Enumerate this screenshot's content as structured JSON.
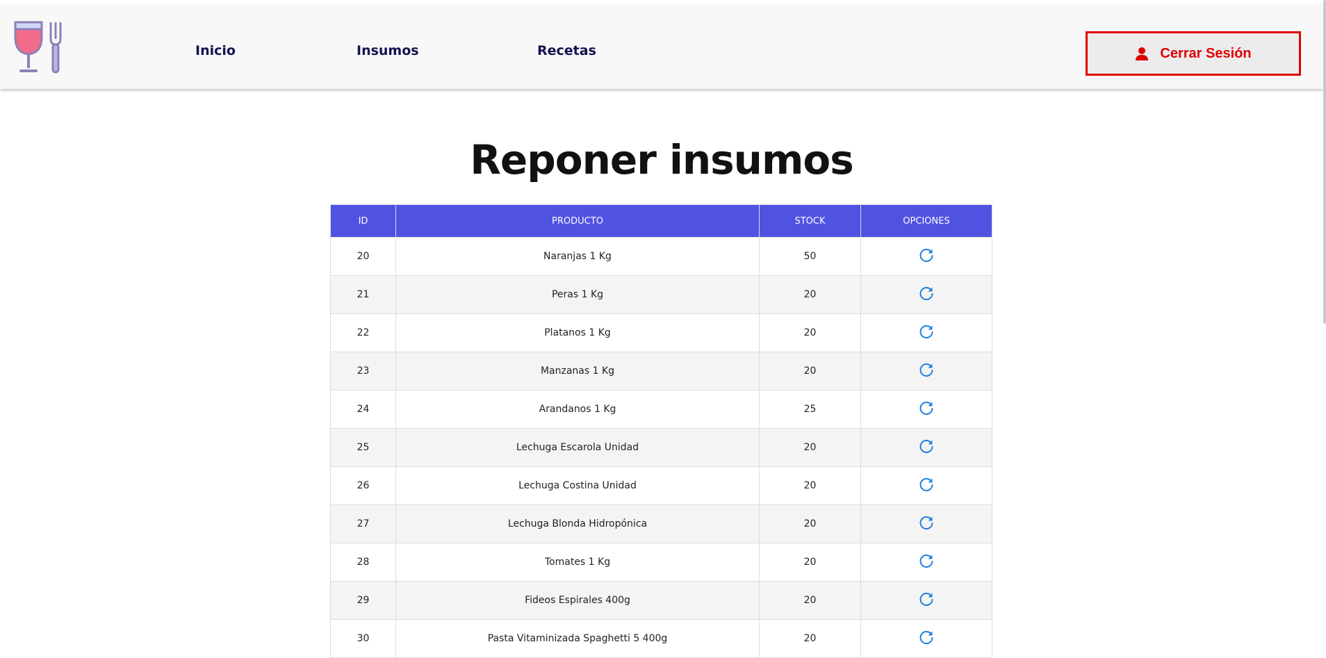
{
  "nav": {
    "links": [
      "Inicio",
      "Insumos",
      "Recetas"
    ],
    "logout_label": "Cerrar Sesión"
  },
  "page": {
    "title": "Reponer insumos"
  },
  "table": {
    "headers": [
      "ID",
      "PRODUCTO",
      "STOCK",
      "OPCIONES"
    ],
    "rows": [
      {
        "id": "20",
        "producto": "Naranjas 1 Kg",
        "stock": "50"
      },
      {
        "id": "21",
        "producto": "Peras 1 Kg",
        "stock": "20"
      },
      {
        "id": "22",
        "producto": "Platanos 1 Kg",
        "stock": "20"
      },
      {
        "id": "23",
        "producto": "Manzanas 1 Kg",
        "stock": "20"
      },
      {
        "id": "24",
        "producto": "Arandanos 1 Kg",
        "stock": "25"
      },
      {
        "id": "25",
        "producto": "Lechuga Escarola Unidad",
        "stock": "20"
      },
      {
        "id": "26",
        "producto": "Lechuga Costina Unidad",
        "stock": "20"
      },
      {
        "id": "27",
        "producto": "Lechuga Blonda Hidropónica",
        "stock": "20"
      },
      {
        "id": "28",
        "producto": "Tomates 1 Kg",
        "stock": "20"
      },
      {
        "id": "29",
        "producto": "Fideos Espirales 400g",
        "stock": "20"
      },
      {
        "id": "30",
        "producto": "Pasta Vitaminizada Spaghetti 5 400g",
        "stock": "20"
      }
    ]
  },
  "icons": {
    "logo": "wine-glass-fork-logo",
    "user": "user-icon",
    "reload": "reload-icon"
  },
  "colors": {
    "accent": "#5052e2",
    "logout": "#e00000",
    "nav_text": "#13124f",
    "reload": "#1e7fe0"
  }
}
